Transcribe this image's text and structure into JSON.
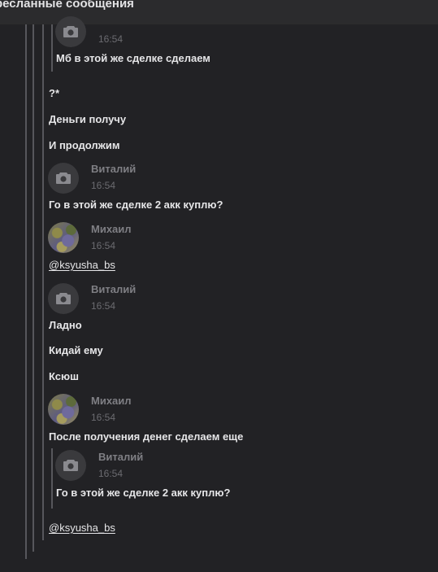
{
  "header": {
    "title": "ресланные сообщения"
  },
  "messages": [
    {
      "time": "16:54",
      "text": "Мб в этой же сделке сделаем"
    },
    {
      "text": "?*"
    },
    {
      "text": "Деньги получу"
    },
    {
      "text": "И продолжим"
    },
    {
      "author": "Виталий",
      "time": "16:54",
      "text": "Го в этой же сделке 2 акк куплю?"
    },
    {
      "author": "Михаил",
      "time": "16:54",
      "text": "@ksyusha_bs"
    },
    {
      "author": "Виталий",
      "time": "16:54",
      "text": "Ладно"
    },
    {
      "text": "Кидай ему"
    },
    {
      "text": "Ксюш"
    },
    {
      "author": "Михаил",
      "time": "16:54",
      "text": "После получения денег сделаем еще"
    },
    {
      "author": "Виталий",
      "time": "16:54",
      "text": "Го в этой же сделке 2 акк куплю?"
    },
    {
      "text": "@ksyusha_bs"
    }
  ],
  "icons": {
    "camera": "camera-icon"
  }
}
